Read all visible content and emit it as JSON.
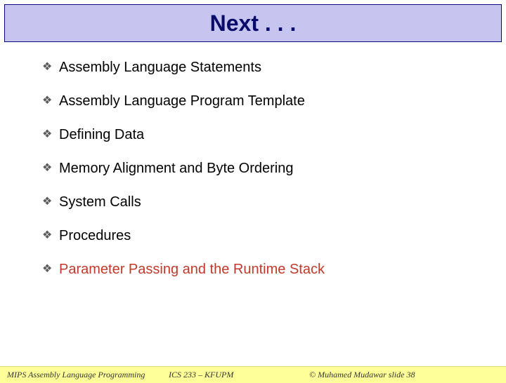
{
  "title": "Next . . .",
  "items": [
    {
      "text": "Assembly Language Statements",
      "highlight": false
    },
    {
      "text": "Assembly Language Program Template",
      "highlight": false
    },
    {
      "text": "Defining Data",
      "highlight": false
    },
    {
      "text": "Memory Alignment and Byte Ordering",
      "highlight": false
    },
    {
      "text": "System Calls",
      "highlight": false
    },
    {
      "text": "Procedures",
      "highlight": false
    },
    {
      "text": "Parameter Passing and the Runtime Stack",
      "highlight": true
    }
  ],
  "footer": {
    "left": "MIPS Assembly Language Programming",
    "center": "ICS 233 – KFUPM",
    "right": "© Muhamed Mudawar   slide 38"
  },
  "bullet_glyph": "❖"
}
